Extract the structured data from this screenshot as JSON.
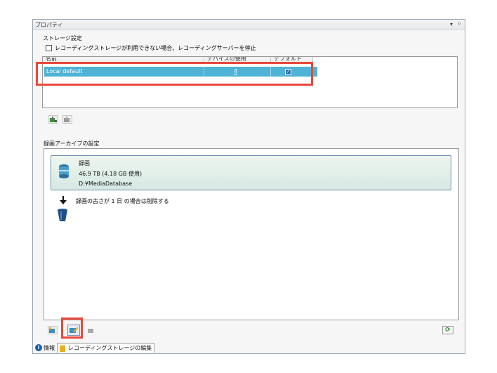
{
  "window": {
    "title": "プロパティ",
    "controls": [
      "▾",
      "ᵖ"
    ]
  },
  "storage": {
    "section_label": "ストレージ設定",
    "stop_checkbox_label": "レコーディングストレージが利用できない場合、レコーディングサーバーを停止",
    "stop_checked": false,
    "columns": [
      "名前",
      "デバイスの使用",
      "デフォルト"
    ],
    "rows": [
      {
        "name": "Local default",
        "devices": "4",
        "default": true
      }
    ]
  },
  "archive": {
    "section_label": "録画アーカイブの設定",
    "card": {
      "title": "録画",
      "size": "46.9 TB (4.18 GB 使用)",
      "path": "D:¥MediaDatabase"
    },
    "delete_rule": "録画の古さが 1 日 の場合は削除する"
  },
  "tabs": [
    {
      "label": "情報"
    },
    {
      "label": "レコーディングストレージの編集"
    }
  ],
  "colors": {
    "selection": "#4fb3d6",
    "highlight": "#e8473a",
    "card_border": "#6a8fb0"
  }
}
